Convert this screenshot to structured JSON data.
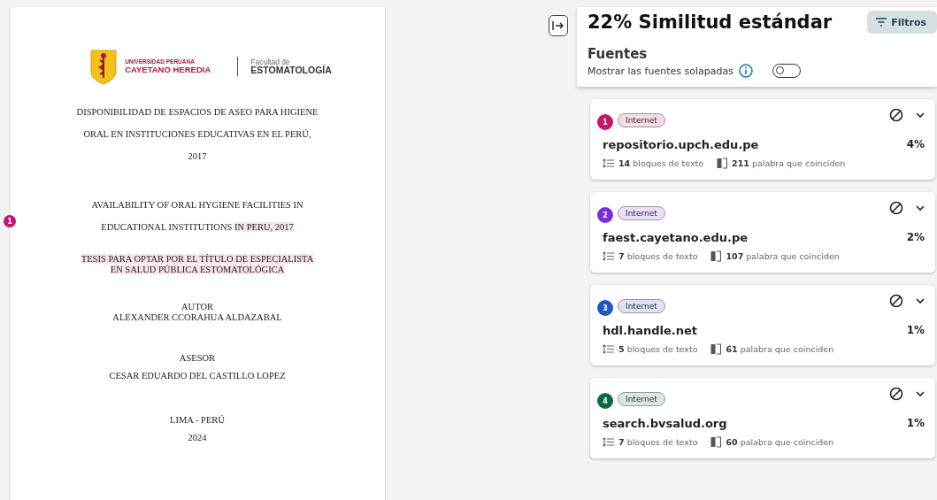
{
  "document": {
    "logo": {
      "university_small": "UNIVERSIDAD PERUANA",
      "university_name": "CAYETANO HEREDIA",
      "faculty_small": "Facultad de",
      "faculty_name": "ESTOMATOLOGÍA"
    },
    "match_marker": {
      "label": "1",
      "color": "#c2186b"
    },
    "blocks": [
      {
        "lines": [
          [
            {
              "text": "DISPONIBILIDAD DE ESPACIOS DE ASEO PARA HIGIENE",
              "highlighted": false
            }
          ],
          [
            {
              "text": "ORAL EN INSTITUCIONES EDUCATIVAS EN EL PERÚ,",
              "highlighted": false
            }
          ],
          [
            {
              "text": "2017",
              "highlighted": false
            }
          ]
        ]
      },
      {
        "lines": [
          [
            {
              "text": "AVAILABILITY OF ORAL HYGIENE FACILITIES IN",
              "highlighted": false
            }
          ],
          [
            {
              "text": "EDUCATIONAL INSTITUTIONS ",
              "highlighted": false
            },
            {
              "text": "IN PERU, 2017",
              "highlighted": true
            }
          ]
        ]
      },
      {
        "lines": [
          [
            {
              "text": "TESIS PARA OPTAR POR EL TÍTULO DE ESPECIALISTA",
              "highlighted": true
            }
          ],
          [
            {
              "text": "EN SALUD PÚBLICA ESTOMATOLÓGICA",
              "highlighted": true
            }
          ]
        ]
      },
      {
        "lines": [
          [
            {
              "text": "AUTOR",
              "highlighted": false
            }
          ],
          [
            {
              "text": "ALEXANDER CCORAHUA ALDAZABAL",
              "highlighted": false
            }
          ]
        ]
      },
      {
        "lines": [
          [
            {
              "text": "ASESOR",
              "highlighted": false
            }
          ],
          [
            {
              "text": "CESAR EDUARDO DEL CASTILLO LOPEZ",
              "highlighted": false
            }
          ]
        ]
      },
      {
        "lines": [
          [
            {
              "text": "LIMA - PERÚ",
              "highlighted": false
            }
          ],
          [
            {
              "text": "2024",
              "highlighted": false
            }
          ]
        ]
      }
    ]
  },
  "panel": {
    "title": "22% Similitud estándar",
    "filter_button": "Filtros",
    "section_title": "Fuentes",
    "overlap_label": "Mostrar las fuentes solapadas",
    "overlap_on": false,
    "sources": [
      {
        "number": "1",
        "color": "#c2186b",
        "tag": "Internet",
        "domain": "repositorio.upch.edu.pe",
        "percent": "4%",
        "blocks": "**14** bloques de texto",
        "words": "**211** palabra que coinciden"
      },
      {
        "number": "2",
        "color": "#7b2ee0",
        "tag": "Internet",
        "domain": "faest.cayetano.edu.pe",
        "percent": "2%",
        "blocks": "**7** bloques de texto",
        "words": "**107** palabra que coinciden"
      },
      {
        "number": "3",
        "color": "#1f56c8",
        "tag": "Internet",
        "domain": "hdl.handle.net",
        "percent": "1%",
        "blocks": "**5** bloques de texto",
        "words": "**61** palabra que coinciden"
      },
      {
        "number": "4",
        "color": "#0f6b3c",
        "tag": "Internet",
        "domain": "search.bvsalud.org",
        "percent": "1%",
        "blocks": "**7** bloques de texto",
        "words": "**60** palabra que coinciden"
      }
    ]
  }
}
